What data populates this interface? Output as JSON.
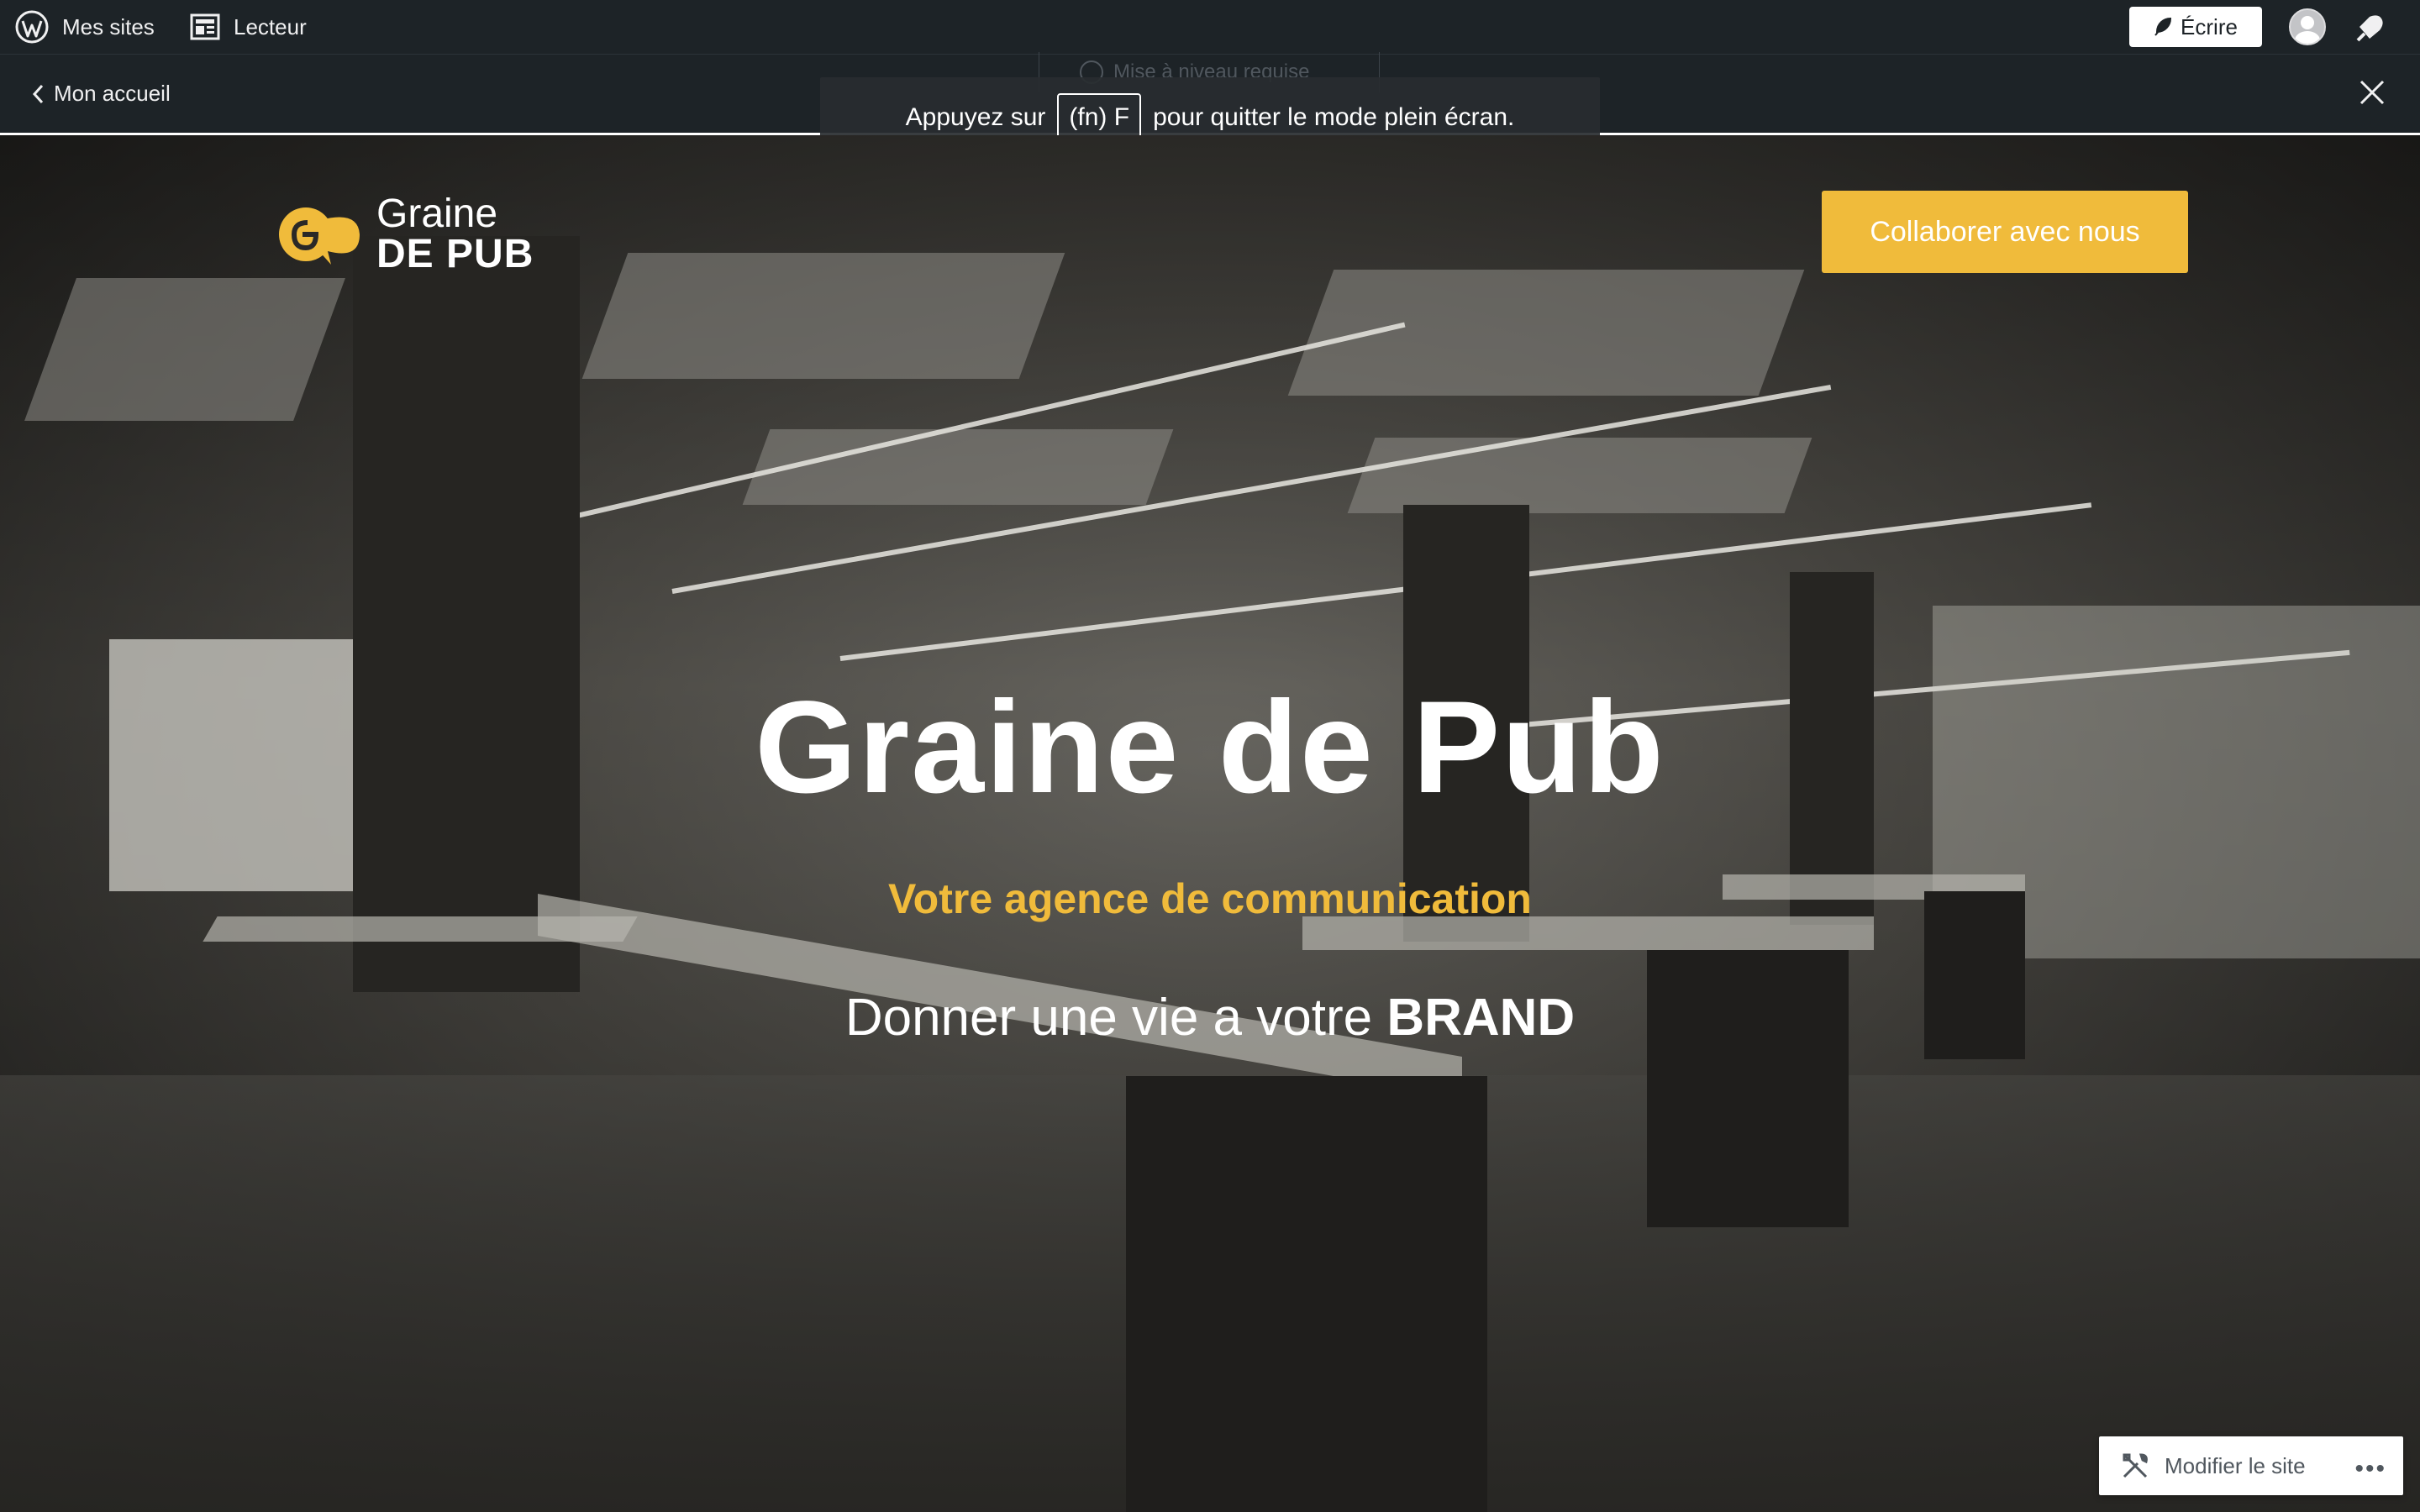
{
  "adminbar": {
    "my_sites": "Mes sites",
    "reader": "Lecteur",
    "write": "Écrire"
  },
  "subbar": {
    "back": "Mon accueil",
    "upgrade": "Mise à niveau requise"
  },
  "fullscreen_toast": {
    "before": "Appuyez sur",
    "key": "(fn) F",
    "after": "pour quitter le mode plein écran."
  },
  "hero": {
    "logo_top": "Graine",
    "logo_bottom": "DE PUB",
    "cta": "Collaborer avec nous",
    "title": "Graine de Pub",
    "subtitle": "Votre agence de communication",
    "tagline_start": "Donner une vie a votre",
    "tagline_bold": "BRAND"
  },
  "footer": {
    "modify": "Modifier le site",
    "more": "•••"
  },
  "colors": {
    "accent": "#f0bb3b",
    "admin_bg": "#1d2327"
  }
}
